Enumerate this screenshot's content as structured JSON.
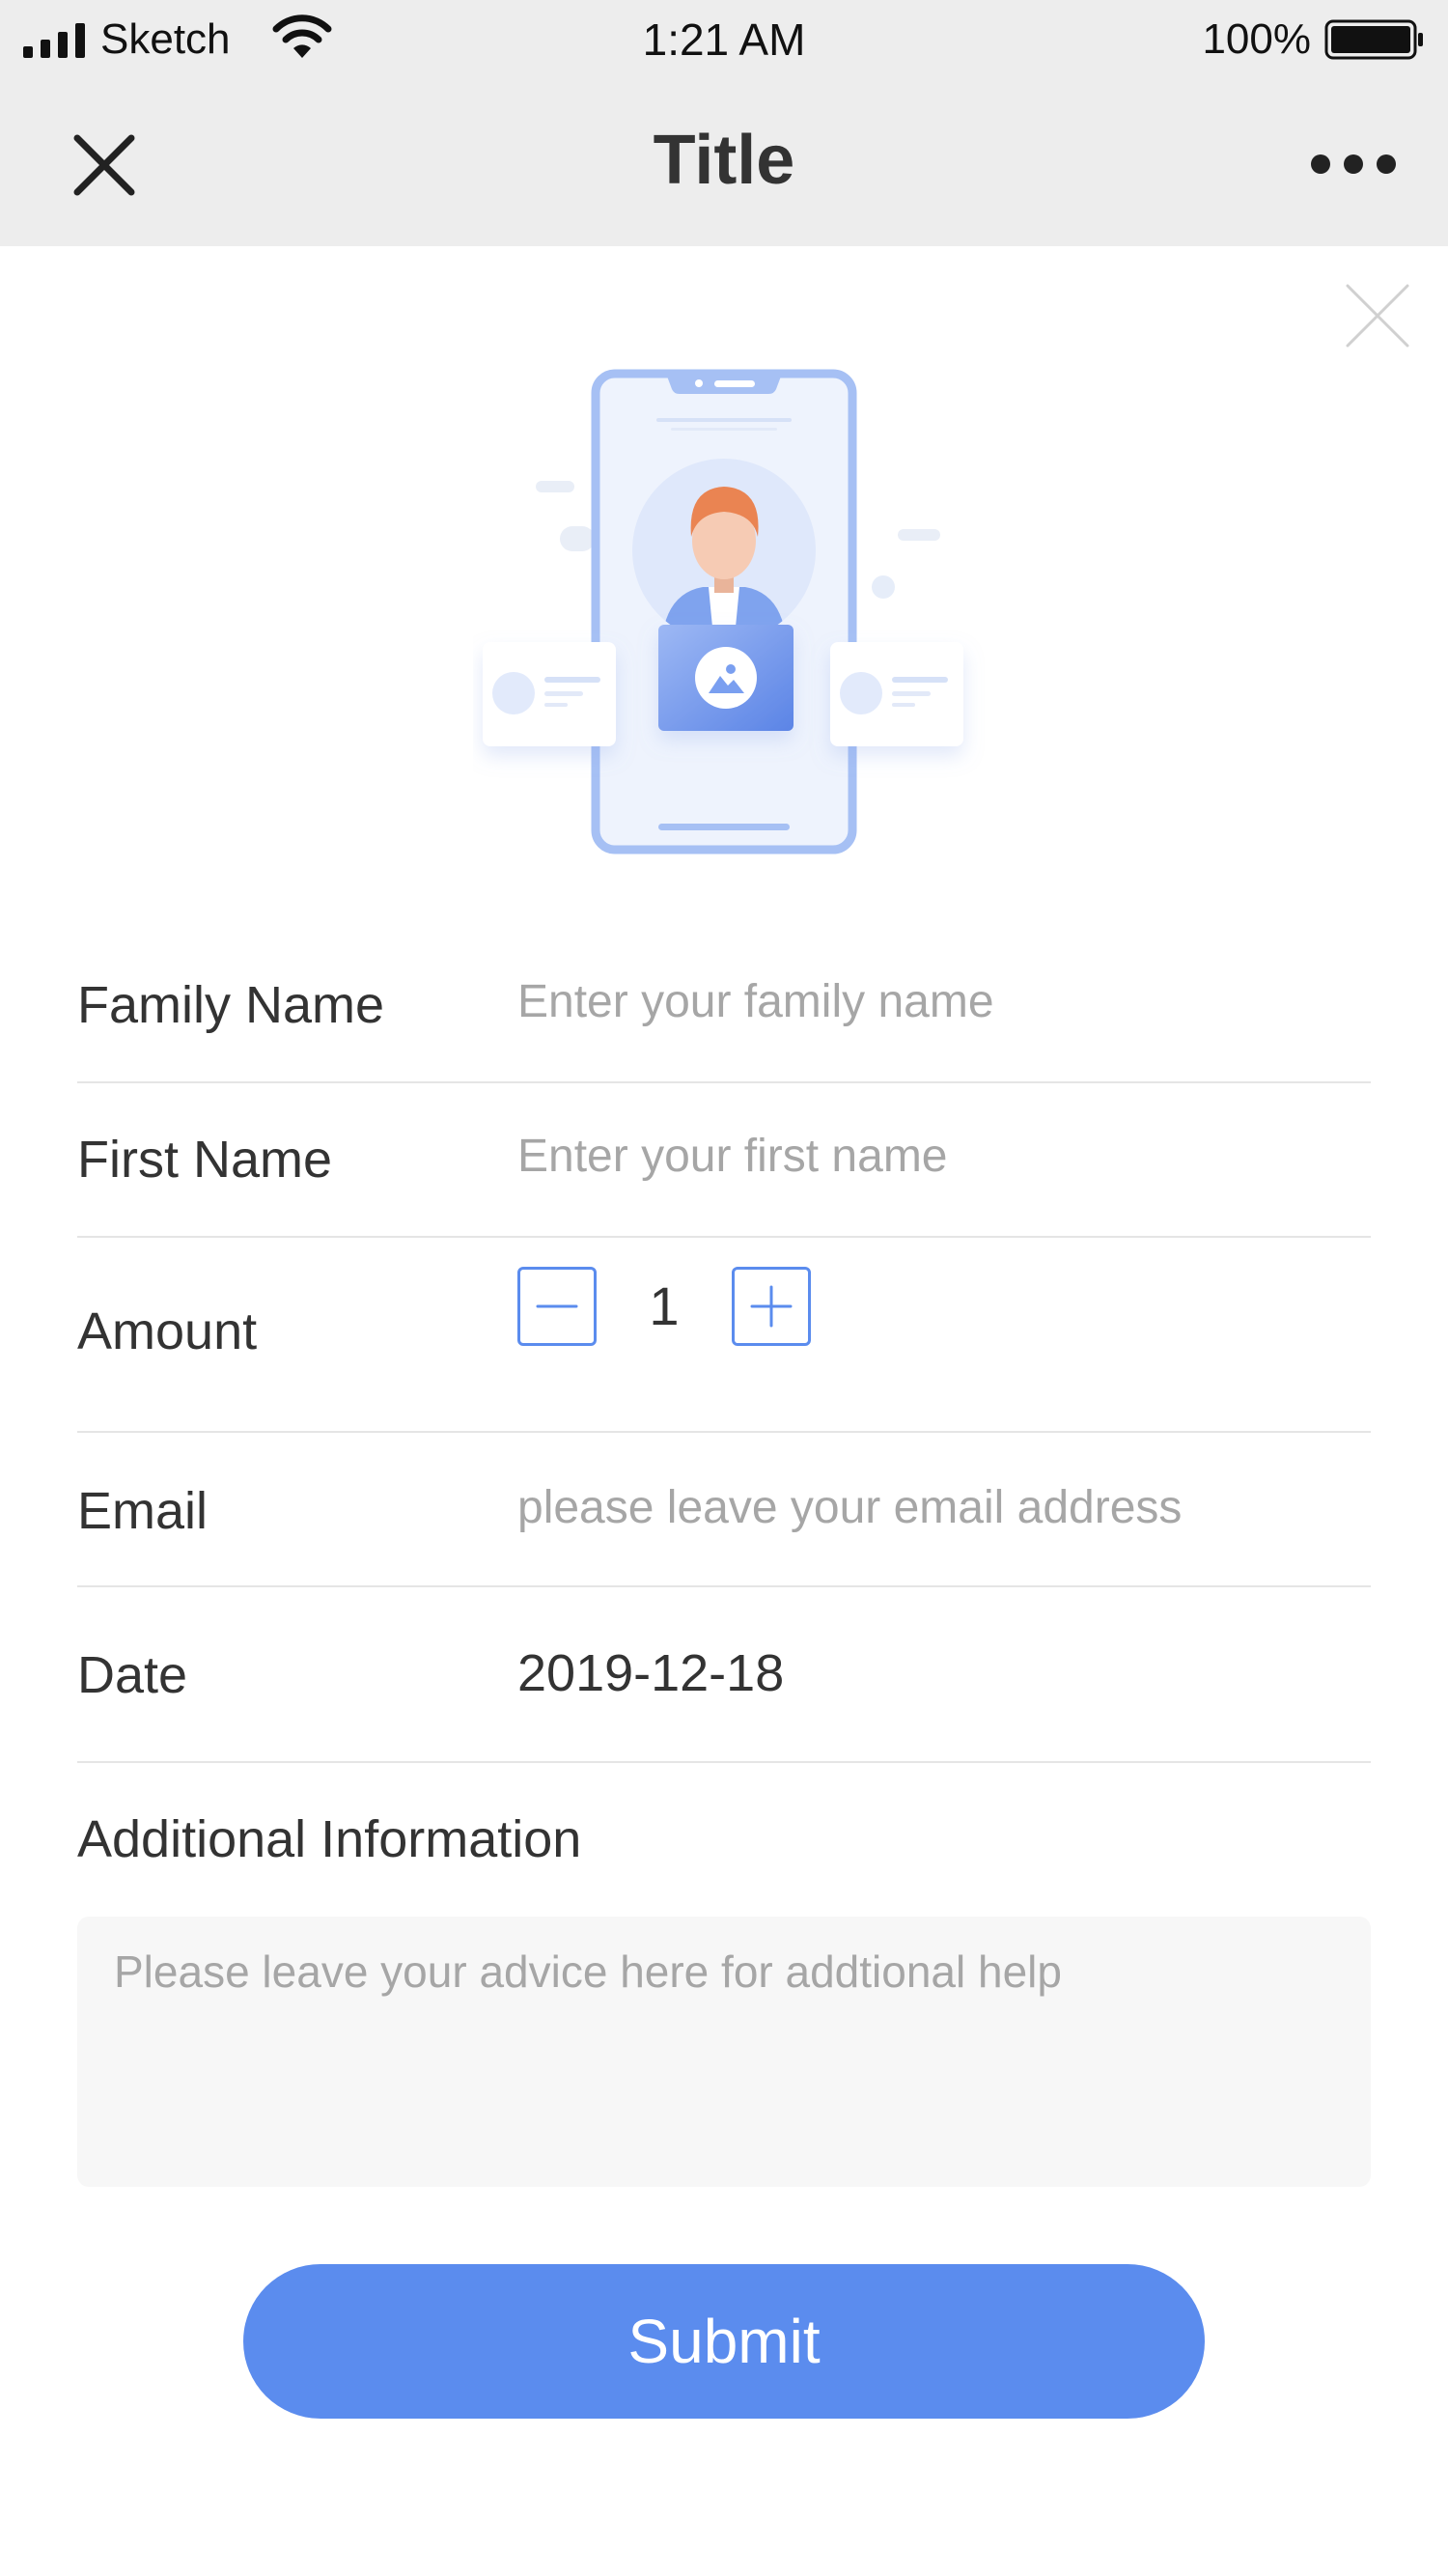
{
  "status_bar": {
    "carrier": "Sketch",
    "time": "1:21 AM",
    "battery_percent": "100%",
    "battery_level": 1.0,
    "icons": [
      "signal-icon",
      "wifi-icon",
      "battery-icon"
    ]
  },
  "nav": {
    "title": "Title",
    "close_icon": "close-icon",
    "more_icon": "more-icon"
  },
  "content": {
    "dismiss_icon": "close-icon",
    "illustration": "phone-profile-illustration"
  },
  "form": {
    "family_name": {
      "label": "Family Name",
      "placeholder": "Enter your family name",
      "value": ""
    },
    "first_name": {
      "label": "First Name",
      "placeholder": "Enter your first name",
      "value": ""
    },
    "amount": {
      "label": "Amount",
      "value": "1",
      "minus_icon": "minus-icon",
      "plus_icon": "plus-icon"
    },
    "email": {
      "label": "Email",
      "placeholder": "please leave your email address",
      "value": ""
    },
    "date": {
      "label": "Date",
      "value": "2019-12-18"
    },
    "additional": {
      "label": "Additional Information",
      "placeholder": "Please leave your advice here for addtional help"
    },
    "submit_label": "Submit"
  },
  "colors": {
    "accent": "#5b8cee",
    "nav_background": "#ededed",
    "placeholder": "#a6a6a6",
    "text": "#333333",
    "divider": "#e5e5e5"
  }
}
